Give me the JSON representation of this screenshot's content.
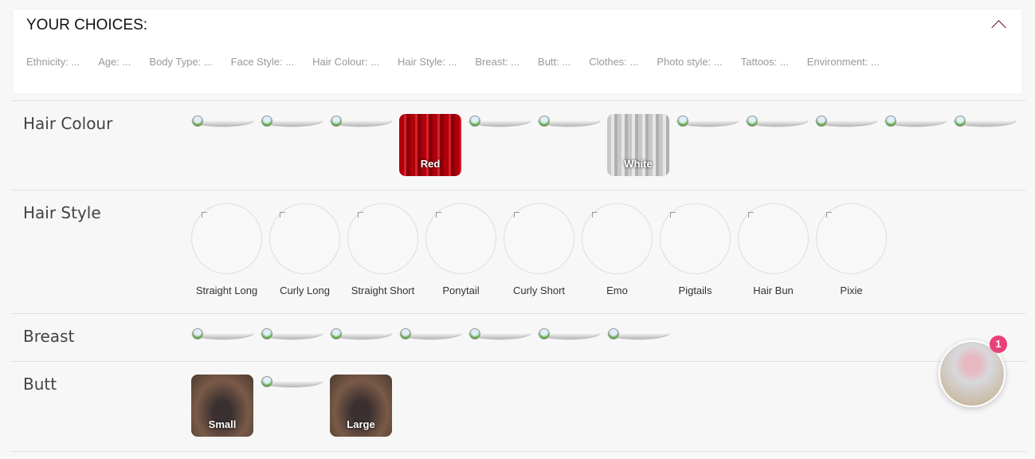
{
  "choices": {
    "title": "YOUR CHOICES:",
    "summary": [
      "Ethnicity: ...",
      "Age: ...",
      "Body Type: ...",
      "Face Style: ...",
      "Hair Colour: ...",
      "Hair Style: ...",
      "Breast: ...",
      "Butt: ...",
      "Clothes: ...",
      "Photo style: ...",
      "Tattoos: ...",
      "Environment: ..."
    ]
  },
  "hair_colour": {
    "title": "Hair Colour",
    "items": [
      null,
      null,
      null,
      "Red",
      null,
      null,
      "White",
      null,
      null,
      null,
      null,
      null
    ]
  },
  "hair_style": {
    "title": "Hair Style",
    "items": [
      "Straight Long",
      "Curly Long",
      "Straight Short",
      "Ponytail",
      "Curly Short",
      "Emo",
      "Pigtails",
      "Hair Bun",
      "Pixie"
    ]
  },
  "breast": {
    "title": "Breast",
    "count": 7
  },
  "butt": {
    "title": "Butt",
    "items": [
      "Small",
      null,
      "Large"
    ]
  },
  "chat": {
    "badge": "1"
  }
}
